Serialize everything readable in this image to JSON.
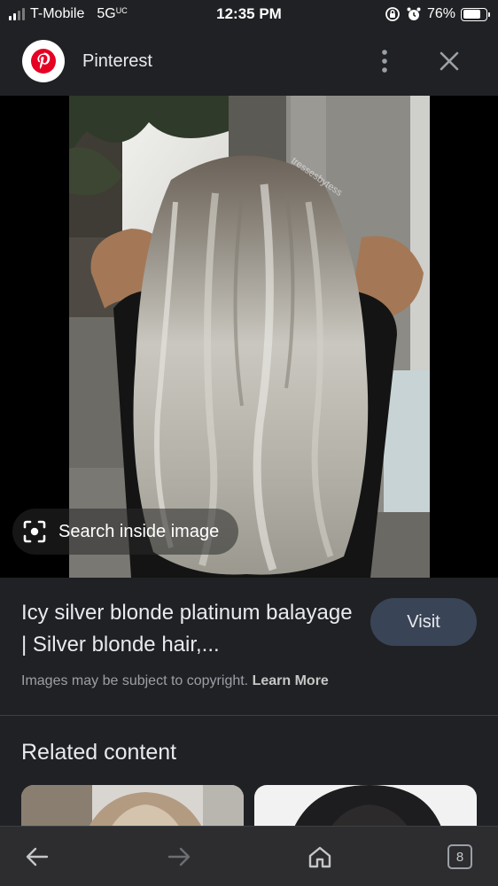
{
  "status_bar": {
    "carrier": "T-Mobile",
    "network": "5G",
    "network_suffix": "UC",
    "time": "12:35 PM",
    "battery": "76%",
    "battery_level": 0.76
  },
  "header": {
    "site_name": "Pinterest",
    "logo_icon": "pinterest-logo",
    "more_icon": "more-vertical-icon",
    "close_icon": "close-icon"
  },
  "image": {
    "watermark": "tressesbytess",
    "search_inside_label": "Search inside image",
    "search_icon": "lens-icon"
  },
  "result": {
    "title": "Icy silver blonde platinum balayage | Silver blonde hair,...",
    "visit_label": "Visit",
    "copyright_text": "Images may be subject to copyright.",
    "learn_more": "Learn More"
  },
  "related": {
    "heading": "Related content"
  },
  "toolbar": {
    "back_icon": "back-arrow-icon",
    "forward_icon": "forward-arrow-icon",
    "home_icon": "home-icon",
    "tabs_count": "8"
  },
  "colors": {
    "background": "#202124",
    "visit_button": "#394457",
    "pinterest_red": "#e60023"
  }
}
